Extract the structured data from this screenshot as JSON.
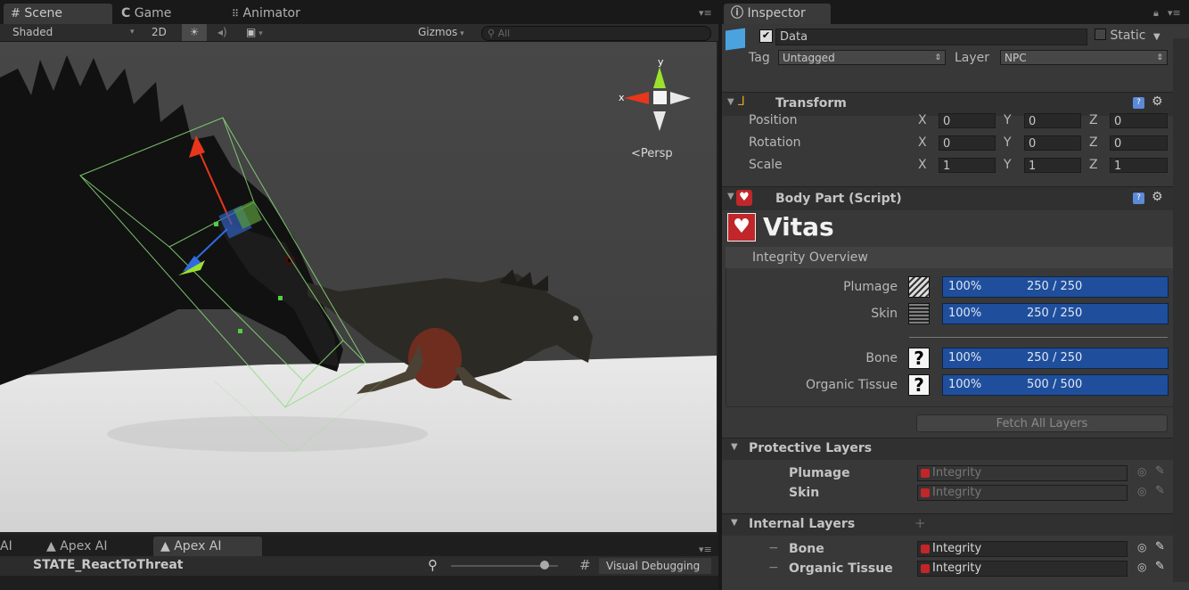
{
  "scene_tabs": {
    "scene": "Scene",
    "game": "Game",
    "animator": "Animator"
  },
  "scene_toolbar": {
    "shading": "Shaded",
    "mode_2d": "2D",
    "gizmos": "Gizmos",
    "search_placeholder": "All",
    "persp": "Persp",
    "axis_x": "x",
    "axis_y": "y"
  },
  "inspector": {
    "tab": "Inspector",
    "object_name": "Data",
    "static_label": "Static",
    "tag_label": "Tag",
    "tag_value": "Untagged",
    "layer_label": "Layer",
    "layer_value": "NPC",
    "transform": {
      "title": "Transform",
      "rows": [
        {
          "label": "Position",
          "x": "0",
          "y": "0",
          "z": "0"
        },
        {
          "label": "Rotation",
          "x": "0",
          "y": "0",
          "z": "0"
        },
        {
          "label": "Scale",
          "x": "1",
          "y": "1",
          "z": "1"
        }
      ],
      "x": "X",
      "y": "Y",
      "z": "Z"
    },
    "body_part": {
      "title": "Body Part (Script)",
      "logo_text": "Vitas",
      "overview_title": "Integrity Overview",
      "layers": [
        {
          "name": "Plumage",
          "percent": "100%",
          "value": "250 / 250",
          "fraction": 1.0
        },
        {
          "name": "Skin",
          "percent": "100%",
          "value": "250 / 250",
          "fraction": 1.0
        },
        {
          "name": "Bone",
          "percent": "100%",
          "value": "250 / 250",
          "fraction": 1.0
        },
        {
          "name": "Organic Tissue",
          "percent": "100%",
          "value": "500 / 500",
          "fraction": 1.0
        }
      ],
      "unknown_glyph": "?",
      "fetch_button": "Fetch All Layers",
      "protective_title": "Protective Layers",
      "protective": [
        {
          "name": "Plumage",
          "ref": "Integrity"
        },
        {
          "name": "Skin",
          "ref": "Integrity"
        }
      ],
      "internal_title": "Internal Layers",
      "internal": [
        {
          "name": "Bone",
          "ref": "Integrity"
        },
        {
          "name": "Organic Tissue",
          "ref": "Integrity"
        }
      ],
      "add_glyph": "+",
      "remove_glyph": "−"
    }
  },
  "bottom_panel": {
    "tab_partial": "AI",
    "tab1": "Apex AI",
    "tab2": "Apex AI",
    "state": "STATE_ReactToThreat",
    "visual_debugging": "Visual Debugging"
  },
  "colors": {
    "bar_blue": "#1f4f9c",
    "heart_red": "#c0262a",
    "gizmo_x": "#e8361c",
    "gizmo_y": "#9be22d"
  }
}
